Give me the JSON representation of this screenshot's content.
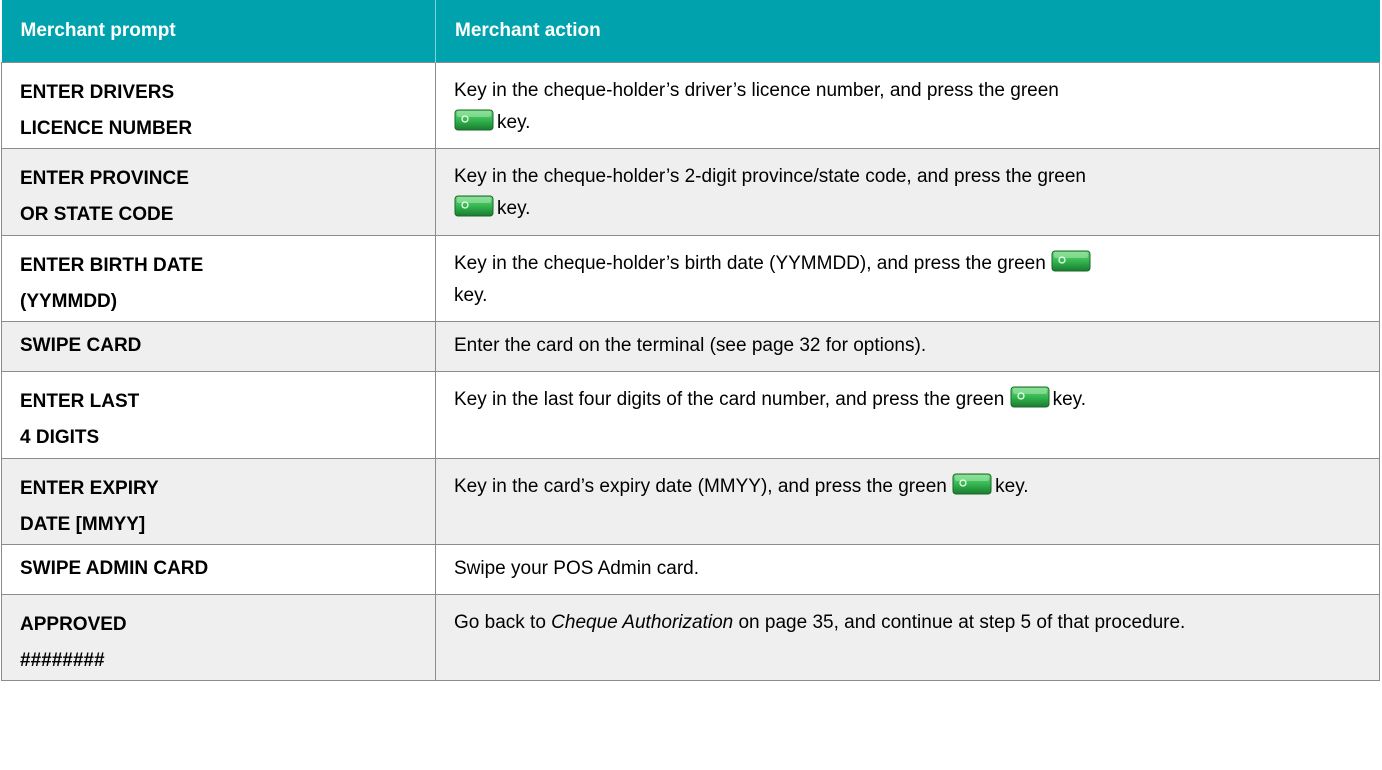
{
  "headers": [
    "Merchant prompt",
    "Merchant action"
  ],
  "rows": [
    {
      "prompt_lines": [
        "ENTER DRIVERS",
        "LICENCE NUMBER"
      ],
      "action_before_key": "Key in the cheque-holder’s driver’s licence number, and press the green",
      "action_after_key": "key."
    },
    {
      "prompt_lines": [
        "ENTER PROVINCE",
        "OR STATE CODE"
      ],
      "action_before_key": "Key in the cheque-holder’s 2-digit province/state code, and press the green",
      "action_after_key": "key."
    },
    {
      "prompt_lines": [
        "ENTER BIRTH DATE",
        "(YYMMDD)"
      ],
      "action_before_key": "Key in the cheque-holder’s birth date (YYMMDD), and press the green",
      "action_after_key": "key."
    },
    {
      "prompt_lines": [
        "SWIPE CARD"
      ],
      "action_text": "Enter the card on the terminal (see page 32 for options)."
    },
    {
      "prompt_lines": [
        "ENTER LAST",
        "4 DIGITS"
      ],
      "action_before_key": "Key in the last four digits of the card number, and press the green",
      "action_after_key": "key."
    },
    {
      "prompt_lines": [
        "ENTER EXPIRY",
        "DATE [MMYY]"
      ],
      "action_before_key": "Key in the card’s expiry date (MMYY), and press the green",
      "action_after_key": "key."
    },
    {
      "prompt_lines": [
        "SWIPE ADMIN CARD"
      ],
      "action_text": "Swipe your POS Admin card."
    },
    {
      "prompt_lines": [
        "APPROVED",
        "########"
      ],
      "action_pre": "Go back to ",
      "action_italic": "Cheque Authorization",
      "action_post": " on page 35, and continue at step 5 of that procedure."
    }
  ],
  "colors": {
    "header_bg": "#00a3ad",
    "header_text": "#ffffff",
    "row_shade": "#efefef",
    "key_green": "#2fb24c"
  },
  "icons": {
    "key": "green-enter-key-icon"
  }
}
